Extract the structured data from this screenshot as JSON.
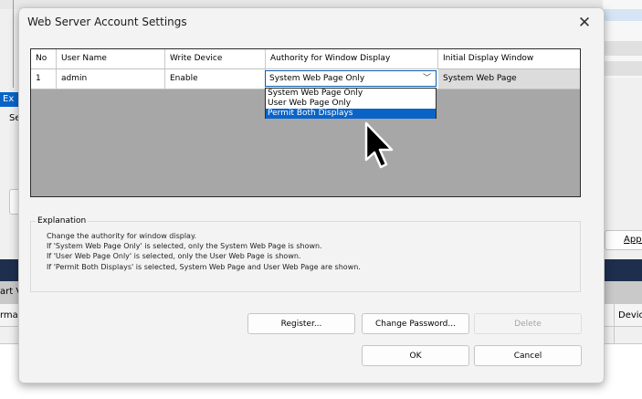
{
  "window": {
    "title": "Web Server Account Settings"
  },
  "background": {
    "left_fragment_1": "Ex",
    "left_fragment_2": "Se",
    "right_button_label": "Appl",
    "bar_left_text": "art V",
    "row_left_text": "rma",
    "row_right_text_1": "s",
    "row_right_text_2": "Devic"
  },
  "table": {
    "columns": [
      "No",
      "User Name",
      "Write Device",
      "Authority for Window Display",
      "Initial Display Window"
    ],
    "rows": [
      {
        "no": "1",
        "user_name": "admin",
        "write_device": "Enable",
        "authority": "System Web Page Only",
        "initial_window": "System Web Page"
      }
    ]
  },
  "dropdown": {
    "options": [
      "System Web Page Only",
      "User Web Page Only",
      "Permit Both Displays"
    ],
    "highlighted": "Permit Both Displays"
  },
  "explanation": {
    "title": "Explanation",
    "lines": [
      "Change the authority for window display.",
      "If 'System Web Page Only' is selected, only the System Web Page is shown.",
      "If 'User Web Page Only' is selected, only the User Web Page is shown.",
      "If 'Permit Both Displays' is selected, System Web Page and User Web Page are shown."
    ]
  },
  "buttons": {
    "register": "Register...",
    "change_password": "Change Password...",
    "delete": "Delete",
    "ok": "OK",
    "cancel": "Cancel"
  },
  "colors": {
    "selection": "#0a64c8",
    "grid_background": "#a7a7a7",
    "dialog_background": "#f3f3f3"
  }
}
